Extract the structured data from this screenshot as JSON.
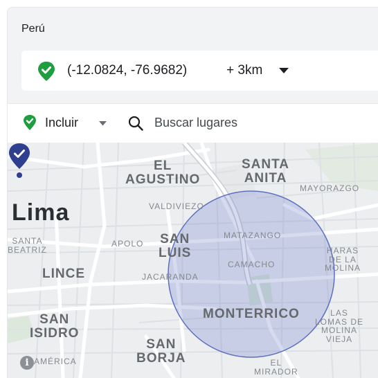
{
  "header": {
    "country": "Perú"
  },
  "location": {
    "coords": "(-12.0824, -76.9682)",
    "radius": "+ 3km",
    "pin_color": "#1e9e3e"
  },
  "filter": {
    "mode": "Incluir",
    "search_placeholder": "Buscar lugares"
  },
  "map": {
    "city": "Lima",
    "labels": {
      "el_agustino": "EL\nAGUSTINO",
      "santa_anita": "SANTA\nANITA",
      "mayorazgo": "MAYORAZGO",
      "valdiviezo": "VALDIVIEZO",
      "matazango": "MATAZANGO",
      "santa_beatriz": "SANTA\nBEATRIZ",
      "apolo": "APOLO",
      "san_luis": "SAN\nLUIS",
      "camacho": "CAMACHO",
      "haras_de_la_molina": "HARAS\nDE LA\nMOLINA",
      "lince": "LINCE",
      "jacaranda": "JACARANDA",
      "monterrico": "MONTERRICO",
      "las_lomas_de_molina_vieja": "LAS\nLOMAS DE\nMOLINA\nVIEJA",
      "san_isidro": "SAN\nISIDRO",
      "san_borja": "SAN\nBORJA",
      "america": "AMÉRICA",
      "el_mirador": "EL\nMIRADOR"
    },
    "circle_color": "#6b7fc9",
    "marker_color": "#2f3f8f"
  }
}
